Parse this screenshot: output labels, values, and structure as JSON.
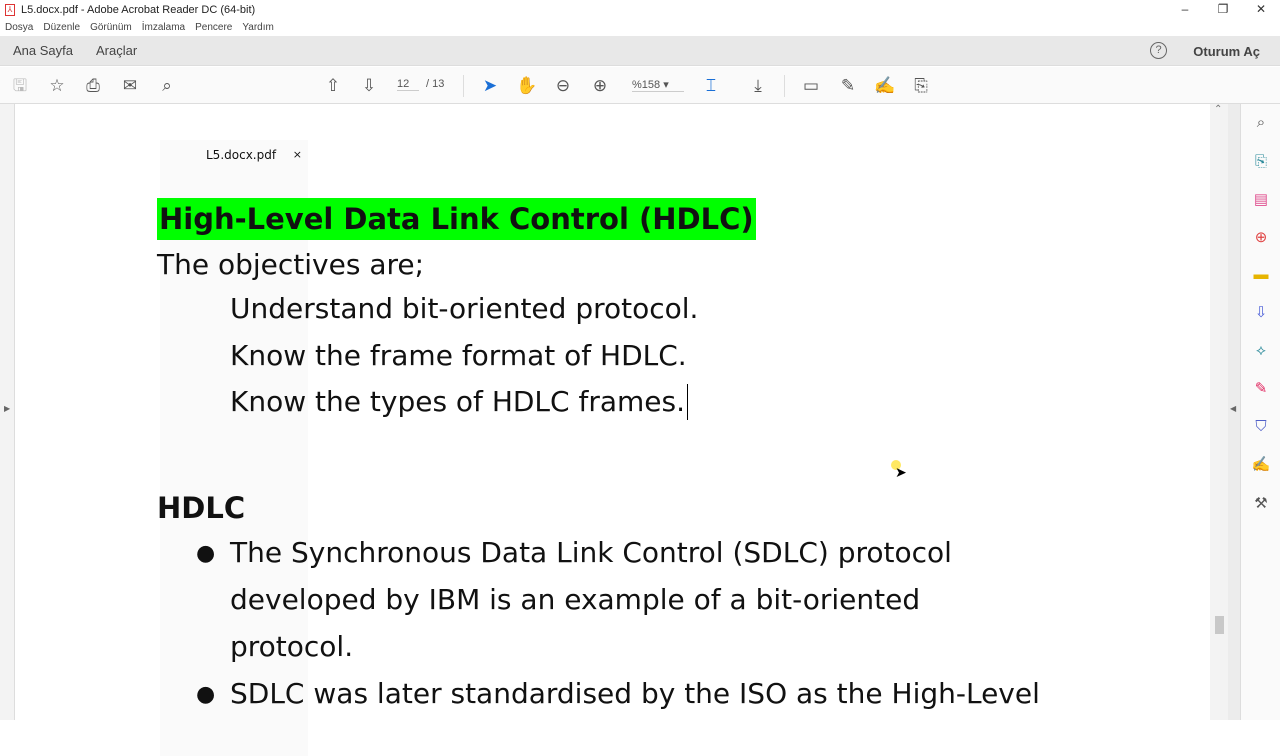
{
  "window": {
    "title": "L5.docx.pdf - Adobe Acrobat Reader DC (64-bit)",
    "minimize": "–",
    "restore": "❐",
    "close": "✕"
  },
  "menu": [
    "Dosya",
    "Düzenle",
    "Görünüm",
    "İmzalama",
    "Pencere",
    "Yardım"
  ],
  "tabs": {
    "home": "Ana Sayfa",
    "tools": "Araçlar",
    "document": "L5.docx.pdf",
    "close": "×"
  },
  "header": {
    "help": "?",
    "login": "Oturum Aç"
  },
  "toolbar": {
    "page_current": "12",
    "page_sep": "/ 13",
    "zoom": "%158"
  },
  "document": {
    "heading": "High-Level Data Link Control (HDLC)",
    "intro": "The objectives are;",
    "objectives": [
      "Understand bit-oriented protocol.",
      "Know the frame format of HDLC.",
      "Know the types of HDLC frames."
    ],
    "section_title": "HDLC",
    "bullets": [
      {
        "lines": [
          "The Synchronous Data Link Control (SDLC) protocol",
          "developed by IBM is an example of a bit-oriented",
          "protocol."
        ]
      },
      {
        "lines": [
          "SDLC was later standardised by the ISO as the High-Level"
        ]
      }
    ]
  },
  "colors": {
    "highlight": "#00ff00"
  }
}
